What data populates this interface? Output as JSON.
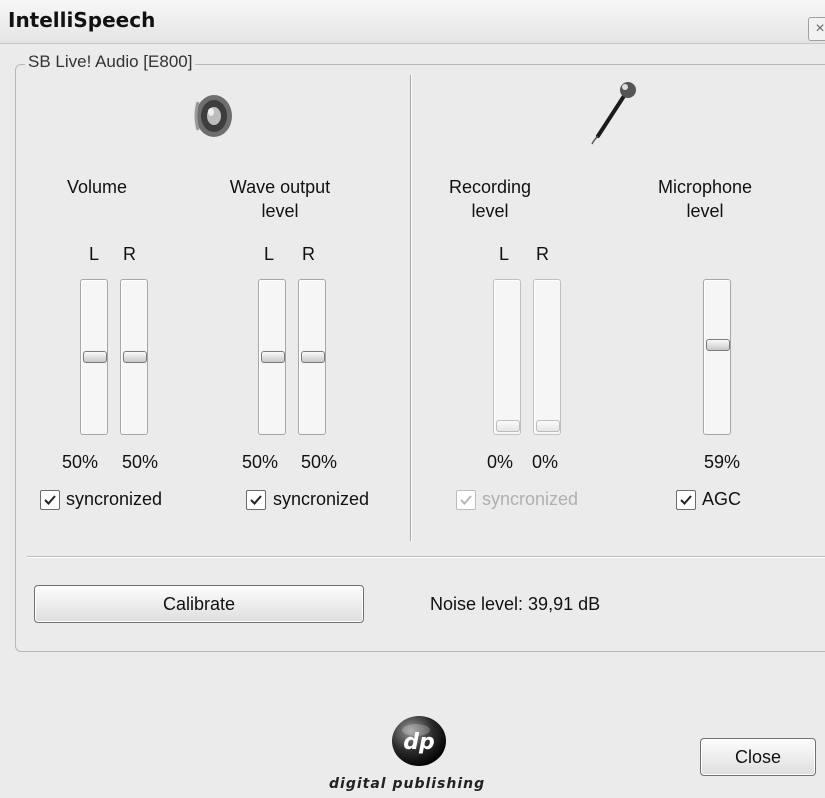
{
  "window": {
    "title": "IntelliSpeech",
    "close_glyph": "×"
  },
  "device_group": {
    "label": "SB Live! Audio [E800]"
  },
  "icons": {
    "speaker": "speaker-icon",
    "microphone": "microphone-icon",
    "logo": "dp-logo"
  },
  "volume": {
    "label": "Volume",
    "left_label": "L",
    "right_label": "R",
    "left_value": 50,
    "right_value": 50,
    "left_pct": "50%",
    "right_pct": "50%",
    "synced_label": "syncronized",
    "synced": true
  },
  "wave": {
    "label_line1": "Wave output",
    "label_line2": "level",
    "left_label": "L",
    "right_label": "R",
    "left_value": 50,
    "right_value": 50,
    "left_pct": "50%",
    "right_pct": "50%",
    "synced_label": "syncronized",
    "synced": true
  },
  "recording": {
    "label_line1": "Recording",
    "label_line2": "level",
    "left_label": "L",
    "right_label": "R",
    "left_value": 0,
    "right_value": 0,
    "left_pct": "0%",
    "right_pct": "0%",
    "synced_label": "syncronized",
    "synced": true,
    "enabled": false
  },
  "microphone": {
    "label_line1": "Microphone",
    "label_line2": "level",
    "value": 59,
    "pct": "59%",
    "agc_label": "AGC",
    "agc": true
  },
  "calibrate": {
    "button_label": "Calibrate",
    "noise_text": "Noise level: 39,91 dB"
  },
  "footer": {
    "close_label": "Close",
    "brand_text": "digital publishing",
    "logo_text": "dp"
  }
}
